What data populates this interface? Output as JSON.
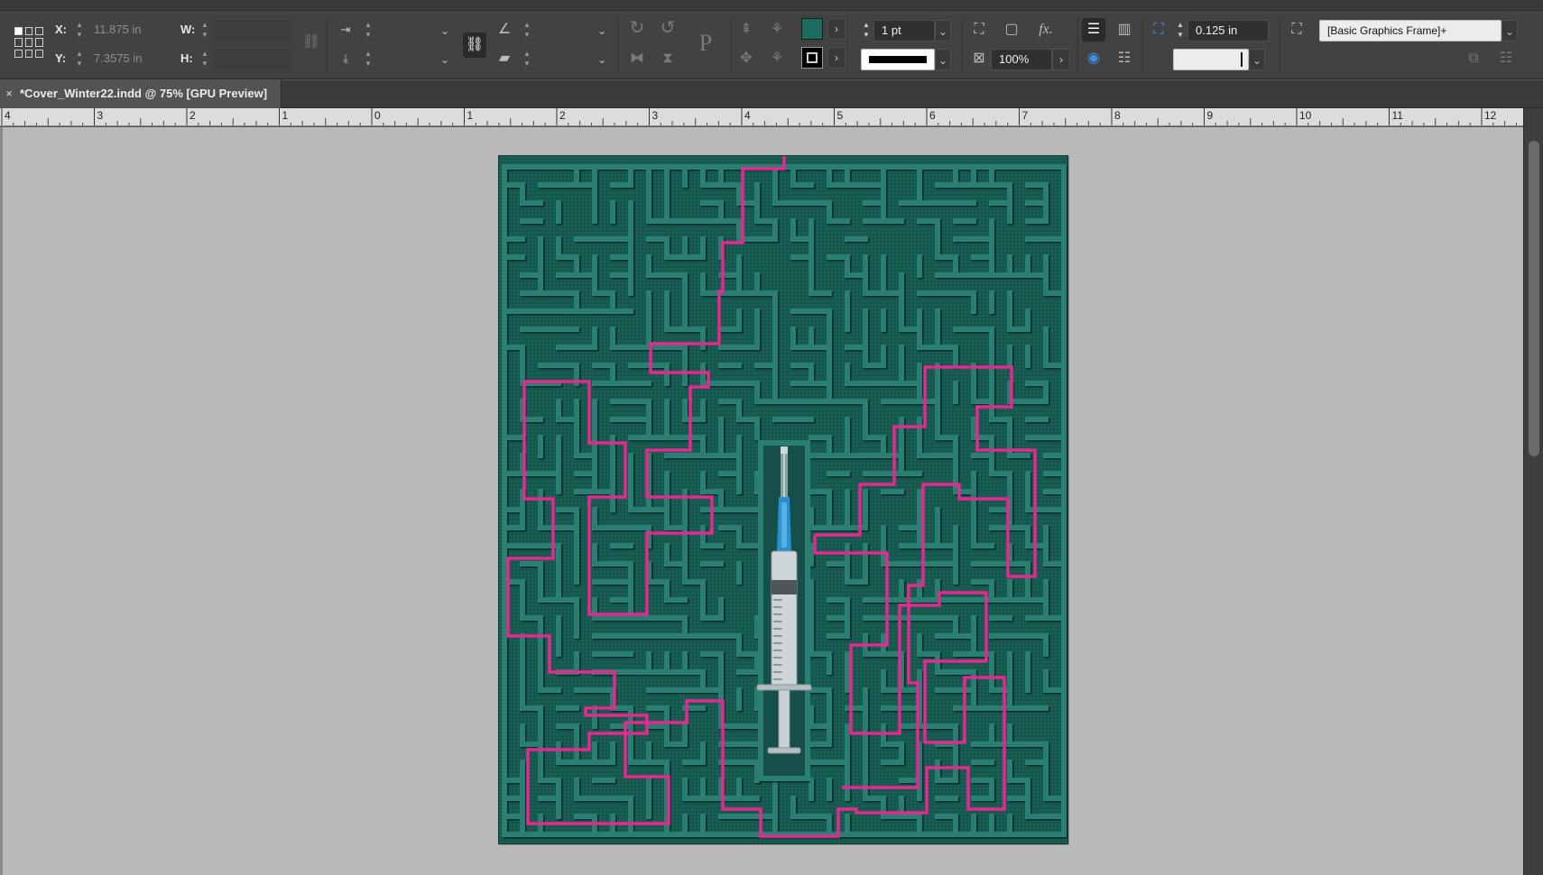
{
  "control_panel": {
    "x_label": "X:",
    "x_value": "11.875 in",
    "y_label": "Y:",
    "y_value": "7.3575 in",
    "w_label": "W:",
    "h_label": "H:",
    "stroke_weight": "1 pt",
    "opacity": "100%",
    "gap_value": "0.125 in",
    "object_style": "[Basic Graphics Frame]+",
    "fill_color": "#1a6d5f",
    "stroke_color": "#000000"
  },
  "document_tab": {
    "close_glyph": "×",
    "title": "*Cover_Winter22.indd @ 75% [GPU Preview]"
  },
  "ruler": {
    "labels": [
      "4",
      "3",
      "2",
      "1",
      "0",
      "1",
      "2",
      "3",
      "4",
      "5",
      "6",
      "7",
      "8",
      "9",
      "10",
      "11",
      "12"
    ]
  },
  "cover": {
    "maze_color": "#16574e",
    "path_color": "#e8278f",
    "syringe_barrel_color": "#cfd6d8",
    "syringe_hub_color": "#2a8fd0"
  }
}
